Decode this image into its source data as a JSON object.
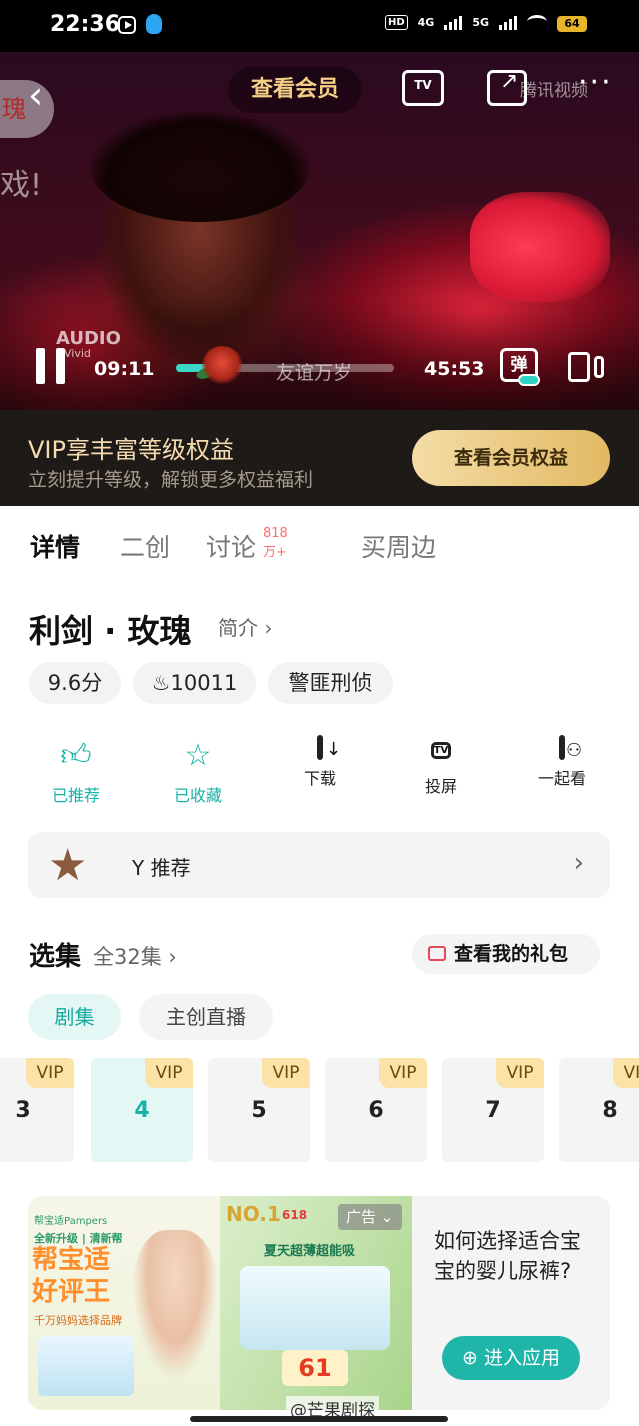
{
  "status_bar": {
    "time": "22:36",
    "network_hd": "HD",
    "network_4g": "4G",
    "network_5g": "5G",
    "battery": "64"
  },
  "player": {
    "side_pill_text": "瑰",
    "side_text": "戏!",
    "member_button": "查看会员",
    "tv_label": "TV",
    "watermark": "腾讯视频",
    "audio_logo": "AUDIO",
    "audio_logo_sub": "Vivid",
    "current_time": "09:11",
    "total_time": "45:53",
    "progress": 0.2,
    "episode_name": "友谊万岁",
    "danmu_label": "弹"
  },
  "vip_banner": {
    "title": "VIP享丰富等级权益",
    "subtitle": "立刻提升等级，解锁更多权益福利",
    "button": "查看会员权益"
  },
  "tabs": [
    {
      "label": "详情",
      "active": true
    },
    {
      "label": "二创",
      "active": false
    },
    {
      "label": "讨论",
      "active": false
    },
    {
      "label": "买周边",
      "active": false
    }
  ],
  "discussion_badge": "818万+",
  "show": {
    "title": "利剑 · 玫瑰",
    "intro_link": "简介 ›",
    "score": "9.6分",
    "heat_icon": "flame-icon",
    "heat": "10011",
    "genre": "警匪刑侦"
  },
  "actions": [
    {
      "label": "已推荐",
      "icon": "thumb-up-icon",
      "active": true
    },
    {
      "label": "已收藏",
      "icon": "star-icon",
      "active": true
    },
    {
      "label": "下载",
      "icon": "download-icon",
      "active": false
    },
    {
      "label": "投屏",
      "icon": "cast-icon",
      "active": false
    },
    {
      "label": "一起看",
      "icon": "watch-together-icon",
      "active": false
    }
  ],
  "recommend": {
    "text": "Y 推荐",
    "arrow": "›"
  },
  "episodes_section": {
    "title": "选集",
    "count": "全32集 ›",
    "gift_button": "查看我的礼包",
    "segments": [
      "剧集",
      "主创直播"
    ],
    "vip_label": "VIP",
    "items": [
      {
        "number": "3",
        "vip": true,
        "active": false
      },
      {
        "number": "4",
        "vip": true,
        "active": true
      },
      {
        "number": "5",
        "vip": true,
        "active": false
      },
      {
        "number": "6",
        "vip": true,
        "active": false
      },
      {
        "number": "7",
        "vip": true,
        "active": false
      },
      {
        "number": "8",
        "vip": true,
        "active": false
      }
    ]
  },
  "ad": {
    "brand": "帮宝适Pampers",
    "new_line": "全新升级 | 清新帮",
    "big_line_1": "帮宝适",
    "big_line_2": "好评王",
    "small_line": "千万妈妈选择品牌",
    "no1": "NO.1",
    "sale_618": "618",
    "summer_line": "夏天超薄超能吸",
    "price": "61",
    "tag": "广告",
    "question": "如何选择适合宝宝的婴儿尿裤?",
    "cta": "进入应用"
  },
  "watermark_bottom": "@芒果剧探",
  "colors": {
    "accent_teal": "#18b2a8",
    "vip_gold": "#e2b963",
    "badge_red": "#ff6e6e"
  }
}
